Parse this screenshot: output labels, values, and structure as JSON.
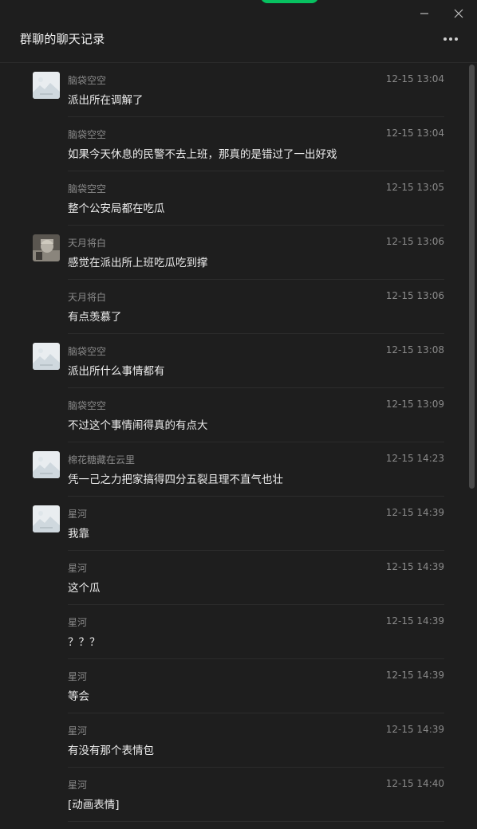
{
  "window": {
    "title": "群聊的聊天记录",
    "accent": "#07c160"
  },
  "icons": {
    "minimize": "minimize-icon",
    "close": "close-icon",
    "more": "more-icon"
  },
  "messages": [
    {
      "name": "脑袋空空",
      "time": "12-15 13:04",
      "text": "派出所在调解了",
      "avatar": "placeholder"
    },
    {
      "name": "脑袋空空",
      "time": "12-15 13:04",
      "text": "如果今天休息的民警不去上班，那真的是错过了一出好戏",
      "avatar": ""
    },
    {
      "name": "脑袋空空",
      "time": "12-15 13:05",
      "text": "整个公安局都在吃瓜",
      "avatar": ""
    },
    {
      "name": "天月将白",
      "time": "12-15 13:06",
      "text": "感觉在派出所上班吃瓜吃到撑",
      "avatar": "photo"
    },
    {
      "name": "天月将白",
      "time": "12-15 13:06",
      "text": "有点羡慕了",
      "avatar": ""
    },
    {
      "name": "脑袋空空",
      "time": "12-15 13:08",
      "text": "派出所什么事情都有",
      "avatar": "placeholder"
    },
    {
      "name": "脑袋空空",
      "time": "12-15 13:09",
      "text": "不过这个事情闹得真的有点大",
      "avatar": ""
    },
    {
      "name": "棉花糖藏在云里",
      "time": "12-15 14:23",
      "text": "凭一己之力把家搞得四分五裂且理不直气也壮",
      "avatar": "placeholder"
    },
    {
      "name": "星河",
      "time": "12-15 14:39",
      "text": "我靠",
      "avatar": "placeholder"
    },
    {
      "name": "星河",
      "time": "12-15 14:39",
      "text": "这个瓜",
      "avatar": ""
    },
    {
      "name": "星河",
      "time": "12-15 14:39",
      "text": "？？？",
      "avatar": ""
    },
    {
      "name": "星河",
      "time": "12-15 14:39",
      "text": "等会",
      "avatar": ""
    },
    {
      "name": "星河",
      "time": "12-15 14:39",
      "text": "有没有那个表情包",
      "avatar": ""
    },
    {
      "name": "星河",
      "time": "12-15 14:40",
      "text": "[动画表情]",
      "avatar": ""
    }
  ]
}
